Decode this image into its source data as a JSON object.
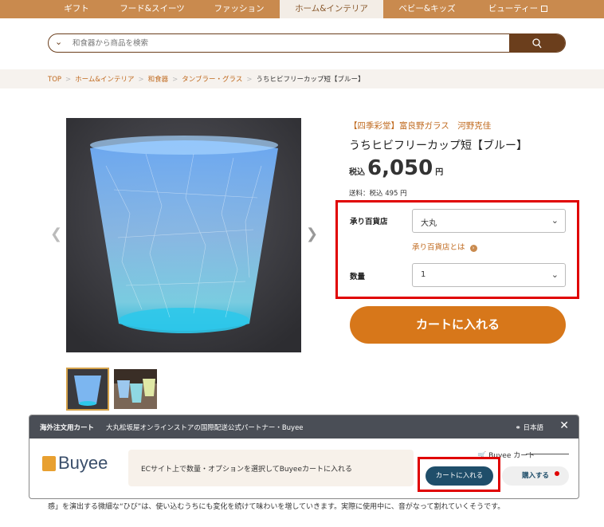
{
  "nav": {
    "tabs": [
      {
        "label": "ギフト"
      },
      {
        "label": "フード&スイーツ"
      },
      {
        "label": "ファッション"
      },
      {
        "label": "ホーム&インテリア"
      },
      {
        "label": "ベビー&キッズ"
      },
      {
        "label": "ビューティー"
      }
    ],
    "active_tab": "ホーム&インテリア"
  },
  "search": {
    "placeholder": "和食器から商品を検索"
  },
  "breadcrumb": {
    "items": [
      "TOP",
      "ホーム&インテリア",
      "和食器",
      "タンブラー・グラス"
    ],
    "current": "うちヒビフリーカップ短【ブルー】",
    "separator": ">"
  },
  "product": {
    "brand": "【四季彩堂】富良野ガラス　河野克佳",
    "name": "うちヒビフリーカップ短【ブルー】",
    "price_prefix": "税込",
    "price": "6,050",
    "price_unit": "円",
    "shipping": "送料：税込 495 円",
    "store_label": "承り百貨店",
    "store_value": "大丸",
    "store_link": "承り百貨店とは",
    "qty_label": "数量",
    "qty_value": "1",
    "cart_button": "カートに入れる"
  },
  "buyee": {
    "title": "海外注文用カート",
    "subtitle": "大丸松坂屋オンラインストアの国際配送公式パートナー・Buyee",
    "lang": "日本語",
    "logo": "Buyee",
    "message": "ECサイト上で数量・オプションを選択してBuyeeカートに入れる",
    "cart_label": "Buyee カート",
    "cart_button": "カートに入れる",
    "buy_button": "購入する"
  },
  "description_tail": "感」を演出する微細な“ひび”は、使い込むうちにも変化を続けて味わいを増していきます。実際に使用中に、音がなって割れていくそうです。",
  "colors": {
    "brand": "#c98a4e",
    "accent": "#d7771a",
    "search": "#6b3e1c",
    "buyee": "#1f4e6a"
  }
}
